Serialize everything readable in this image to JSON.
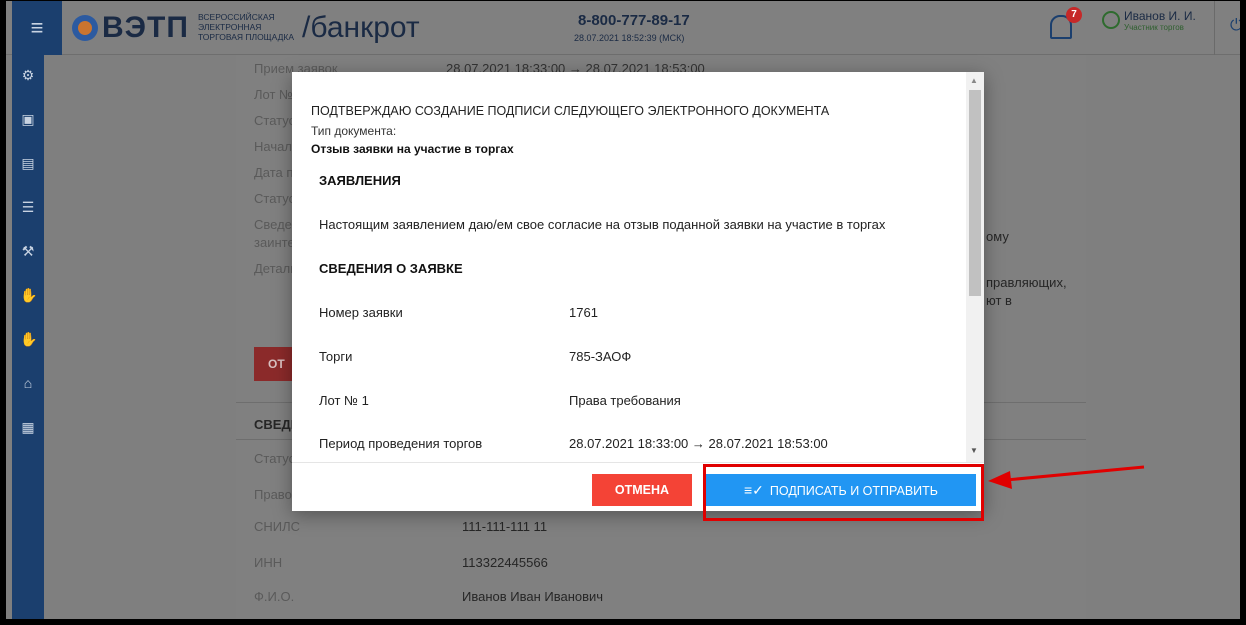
{
  "header": {
    "logo_text": "ВЭТП",
    "logo_subtitle": "ВСЕРОССИЙСКАЯ ЭЛЕКТРОННАЯ ТОРГОВАЯ ПЛОЩАДКА",
    "section": "/банкрот",
    "phone": "8-800-777-89-17",
    "datetime": "28.07.2021 18:52:39 (МСК)",
    "notifications_count": "7",
    "user_name": "Иванов И. И.",
    "user_role": "Участник торгов"
  },
  "sidebar": {
    "icons": [
      "gear-icon",
      "document-icon",
      "scroll-icon",
      "list-icon",
      "gavel-icon",
      "hand-icon",
      "hand-coin-icon",
      "house-icon",
      "id-card-icon"
    ]
  },
  "background": {
    "labels": [
      "Прием заявок",
      "Лот №",
      "Статус",
      "Начало",
      "Дата п",
      "Статус",
      "Сведе",
      "заинте",
      "Детали"
    ],
    "fragments": [
      "28.07.2021 18:33:00 → 28.07.2021 18:53:00",
      "ому",
      "правляющих,",
      "ют в"
    ],
    "red_button": "ОТ",
    "section_title": "СВЕДЕ",
    "rows2": [
      {
        "label": "Статус",
        "value": ""
      },
      {
        "label": "Право",
        "value": ""
      },
      {
        "label": "СНИЛС",
        "value": "111-111-111 11"
      },
      {
        "label": "ИНН",
        "value": "113322445566"
      },
      {
        "label": "Ф.И.О.",
        "value": "Иванов Иван Иванович"
      }
    ]
  },
  "modal": {
    "confirm_text": "ПОДТВЕРЖДАЮ СОЗДАНИЕ ПОДПИСИ СЛЕДУЮЩЕГО ЭЛЕКТРОННОГО ДОКУМЕНТА",
    "doc_type_label": "Тип документа:",
    "doc_type_value": "Отзыв заявки на участие в торгах",
    "heading1": "ЗАЯВЛЕНИЯ",
    "statement": "Настоящим заявлением даю/ем свое согласие на отзыв поданной заявки на участие в торгах",
    "heading2": "СВЕДЕНИЯ О ЗАЯВКЕ",
    "rows": [
      {
        "label": "Номер заявки",
        "value": "1761"
      },
      {
        "label": "Торги",
        "value": "785-ЗАОФ"
      },
      {
        "label": "Лот № 1",
        "value": "Права требования"
      },
      {
        "label": "Период проведения торгов",
        "value": "28.07.2021 18:33:00 → 28.07.2021 18:53:00"
      }
    ],
    "cancel_label": "ОТМЕНА",
    "sign_label": "ПОДПИСАТЬ И ОТПРАВИТЬ"
  },
  "colors": {
    "sidebar": "#1b3f6e",
    "cancel": "#f44336",
    "sign": "#2196f3",
    "annotation": "#e00000"
  }
}
